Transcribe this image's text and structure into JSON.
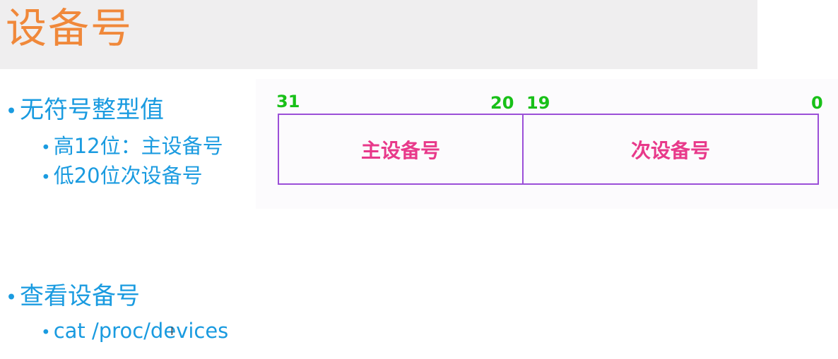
{
  "title": "设备号",
  "bullets": {
    "b1": "无符号整型值",
    "b1_sub1": "高12位：主设备号",
    "b1_sub2": "低20位次设备号",
    "b2": "查看设备号",
    "b2_sub1": "cat /proc/devices"
  },
  "diagram": {
    "bits": {
      "major_high": "31",
      "major_low": "20",
      "minor_high": "19",
      "minor_low": "0"
    },
    "fields": {
      "major": "主设备号",
      "minor": "次设备号"
    }
  },
  "colors": {
    "title": "#f0883a",
    "bullet_text": "#1a9be0",
    "bit_numbers": "#18c018",
    "field_text": "#e8398a",
    "field_border": "#9b4fd8"
  }
}
